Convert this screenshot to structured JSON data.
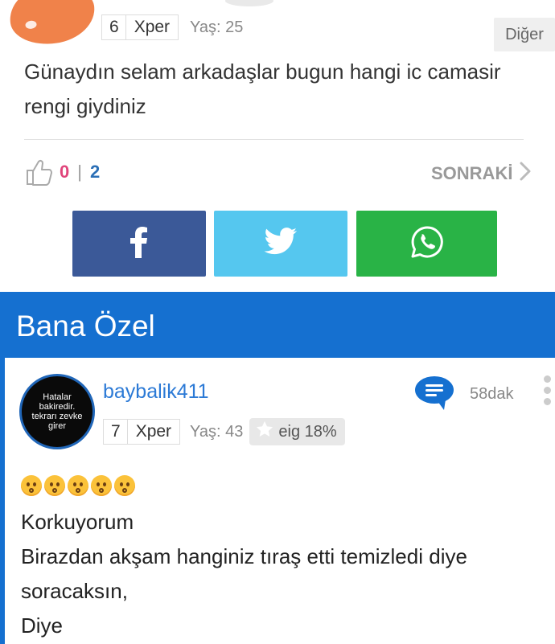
{
  "post": {
    "level": "6",
    "xp_label": "Xper",
    "age": "Yaş: 25",
    "other_button": "Diğer",
    "question": "Günaydın selam arkadaşlar bugun hangi ic camasir rengi giydiniz",
    "likes": "0",
    "separator": "|",
    "dislikes": "2",
    "next_label": "SONRAKİ"
  },
  "share": {
    "facebook_color": "#3b5998",
    "twitter_color": "#55c7ef",
    "whatsapp_color": "#29b346"
  },
  "section": {
    "title": "Bana Özel",
    "color": "#1570d0"
  },
  "answer": {
    "avatar_text": [
      "Hatalar",
      "bakiredir.",
      "tekrarı zevke",
      "girer"
    ],
    "username": "baybalik411",
    "time": "58dak",
    "level": "7",
    "xp_label": "Xper",
    "age": "Yaş: 43",
    "eig": "eig 18%",
    "emoji_count": 5,
    "lines": [
      "Korkuyorum",
      "Birazdan akşam hanginiz tıraş etti temizledi diye",
      "soracaksın,",
      "Diye"
    ]
  }
}
